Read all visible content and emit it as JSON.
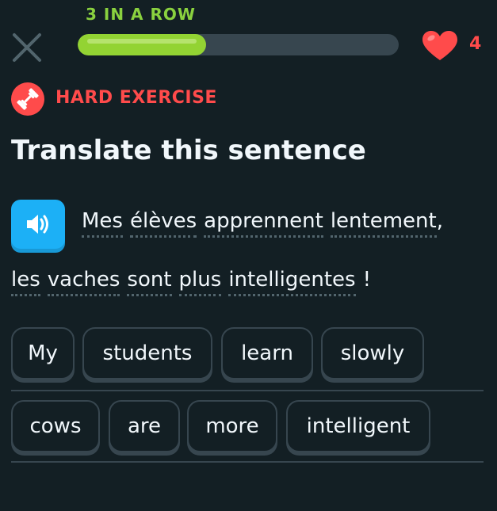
{
  "header": {
    "streak_label": "3 IN A ROW",
    "progress_fraction": 0.4,
    "hearts": "4"
  },
  "badge": {
    "label": "HARD EXERCISE"
  },
  "prompt": {
    "title": "Translate this sentence",
    "sentence_line1": [
      "Mes",
      "élèves",
      "apprennent",
      "lentement",
      ","
    ],
    "sentence_line2": [
      "les",
      "vaches",
      "sont",
      "plus",
      "intelligentes",
      "!"
    ]
  },
  "answer": {
    "tiles_row1": [
      "My",
      "students",
      "learn",
      "slowly"
    ],
    "tiles_row2": [
      "cows",
      "are",
      "more",
      "intelligent"
    ]
  },
  "colors": {
    "background": "#131f24",
    "streak_green": "#8ad13f",
    "progress_fill": "#93d333",
    "heart_red": "#ff4b4b",
    "speaker_blue": "#1cb0f6",
    "tile_border": "#37464f"
  },
  "icons": {
    "close": "close-icon",
    "heart": "heart-icon",
    "badge": "dumbbell-icon",
    "speaker": "speaker-icon"
  }
}
